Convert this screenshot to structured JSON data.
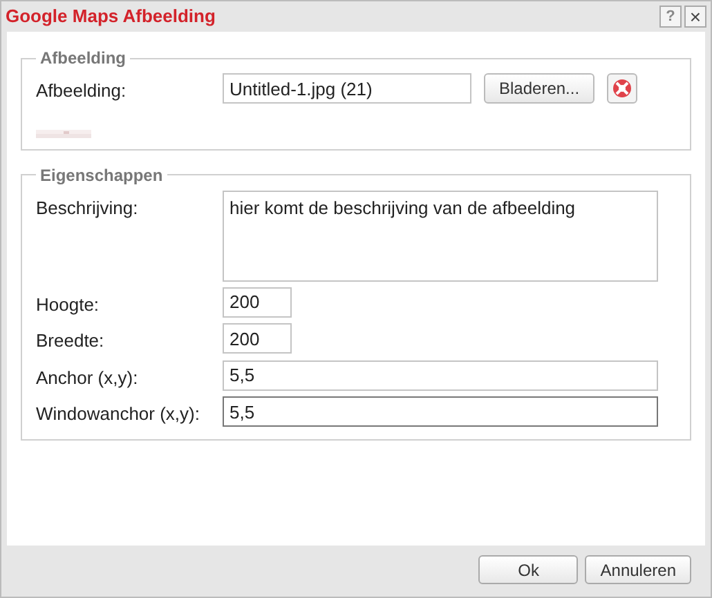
{
  "window": {
    "title": "Google Maps Afbeelding",
    "buttons": [
      {
        "kind": "help",
        "label": "?"
      },
      {
        "kind": "close",
        "label": "×"
      }
    ]
  },
  "sections": [
    {
      "legend": "Afbeelding",
      "rows": [
        {
          "kind": "file",
          "label": "Afbeelding:",
          "value": "Untitled-1.jpg (21)",
          "button": "Bladeren..."
        }
      ],
      "preview": {
        "kind": "picture"
      }
    },
    {
      "legend": "Eigenschappen",
      "rows": [
        {
          "kind": "textarea",
          "label": "Beschrijving:",
          "value": "hier komt de beschrijving van de afbeelding",
          "focused": false
        },
        {
          "kind": "short",
          "label": "Hoogte:",
          "value": "200",
          "focused": false
        },
        {
          "kind": "short",
          "label": "Breedte:",
          "value": "200",
          "focused": false
        },
        {
          "kind": "long",
          "label": "Anchor (x,y):",
          "value": "5,5",
          "focused": false
        },
        {
          "kind": "long",
          "label": "Windowanchor (x,y):",
          "value": "5,5",
          "focused": true
        }
      ]
    }
  ],
  "footer": {
    "buttons": [
      "Ok",
      "Annuleren"
    ]
  }
}
